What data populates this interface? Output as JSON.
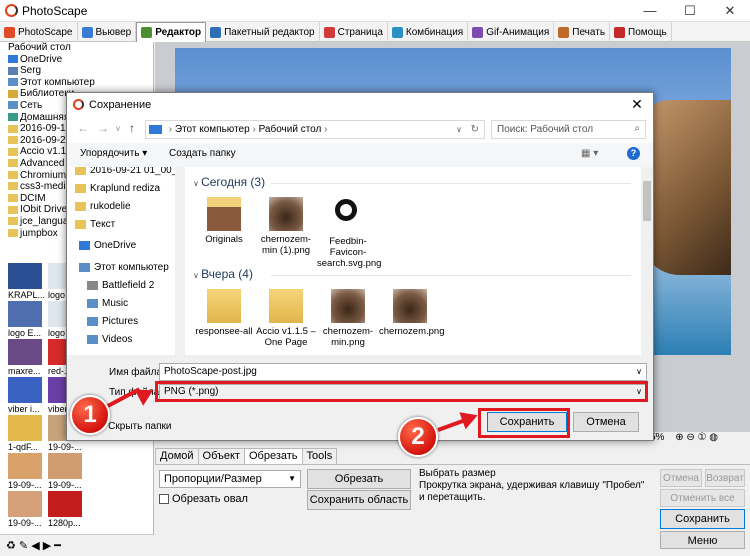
{
  "app": {
    "title": "PhotoScape",
    "minimize": "—",
    "maximize": "☐",
    "close": "✕"
  },
  "tabs": [
    {
      "label": "PhotoScape",
      "color": "#e24b2a"
    },
    {
      "label": "Вьювер",
      "color": "#3a7bd5"
    },
    {
      "label": "Редактор",
      "color": "#4b8d2f"
    },
    {
      "label": "Пакетный редактор",
      "color": "#2f6fb5"
    },
    {
      "label": "Страница",
      "color": "#d13b3b"
    },
    {
      "label": "Комбинация",
      "color": "#2a8fc4"
    },
    {
      "label": "Gif-Анимация",
      "color": "#7b4bb0"
    },
    {
      "label": "Печать",
      "color": "#c06a2a"
    },
    {
      "label": "Помощь",
      "color": "#c42a2a"
    }
  ],
  "tree": [
    "Рабочий стол",
    "OneDrive",
    "Serg",
    "Этот компьютер",
    "Библиотеки",
    "Сеть",
    "Домашняя группа",
    "2016-09-1",
    "2016-09-2",
    "Accio v1.1",
    "Advanced",
    "Chromium",
    "css3-media",
    "DCIM",
    "IObit Drive",
    "jce_langua",
    "jumpbox"
  ],
  "thumbs": [
    {
      "label": "KRAPL..."
    },
    {
      "label": "logo"
    },
    {
      "label": "logo E..."
    },
    {
      "label": "logo"
    },
    {
      "label": "maxre..."
    },
    {
      "label": "red-..."
    },
    {
      "label": "viber i..."
    },
    {
      "label": "viber"
    },
    {
      "label": "1-qdF..."
    },
    {
      "label": "19-09-..."
    },
    {
      "label": "19-09-..."
    },
    {
      "label": "19-09-..."
    },
    {
      "label": "19-09-..."
    },
    {
      "label": "1280p..."
    }
  ],
  "zoom": {
    "value": "5%"
  },
  "bottom": {
    "tabs": [
      "Домой",
      "Объект",
      "Обрезать",
      "Tools"
    ],
    "active_tab": "Обрезать",
    "crop_mode": "Пропорции/Размер",
    "crop_button": "Обрезать",
    "oval_checkbox": "Обрезать овал",
    "save_area_button": "Сохранить область",
    "hint_title": "Выбрать размер",
    "hint_text": "Прокрутка экрана, удерживая клавишу \"Пробел\" и перетащить.",
    "undo": "Отмена",
    "redo": "Возврат",
    "undo_all": "Отменить все",
    "save": "Сохранить",
    "menu": "Меню"
  },
  "dialog": {
    "title": "Сохранение",
    "close": "✕",
    "path": [
      "Этот компьютер",
      "Рабочий стол"
    ],
    "search_placeholder": "Поиск: Рабочий стол",
    "organize": "Упорядочить ▾",
    "new_folder": "Создать папку",
    "help": "?",
    "nav_items": [
      {
        "label": "2016-09-21 01_00_",
        "color": "#e8c35a"
      },
      {
        "label": "Kraplund rediza",
        "color": "#e8c35a"
      },
      {
        "label": "rukodelie",
        "color": "#e8c35a"
      },
      {
        "label": "Текст",
        "color": "#e8c35a"
      },
      {
        "label": "OneDrive",
        "color": "#2f7ad6"
      },
      {
        "label": "Этот компьютер",
        "color": "#5a8ec6"
      },
      {
        "label": "Battlefield 2",
        "color": "#888888"
      },
      {
        "label": "Music",
        "color": "#5a8ec6"
      },
      {
        "label": "Pictures",
        "color": "#5a8ec6"
      },
      {
        "label": "Videos",
        "color": "#5a8ec6"
      }
    ],
    "groups": [
      {
        "label": "Сегодня (3)",
        "files": [
          {
            "name": "Originals",
            "kind": "folder-photo"
          },
          {
            "name": "chernozem-min (1).png",
            "kind": "soil"
          },
          {
            "name": "Feedbin-Favicon-search.svg.png",
            "kind": "search"
          }
        ]
      },
      {
        "label": "Вчера (4)",
        "files": [
          {
            "name": "responsee-all",
            "kind": "folder-doc"
          },
          {
            "name": "Accio v1.1.5 – One Page",
            "kind": "folder-doc"
          },
          {
            "name": "chernozem-min.png",
            "kind": "soil"
          },
          {
            "name": "chernozem.png",
            "kind": "soil"
          }
        ]
      }
    ],
    "filename_label": "Имя файла:",
    "filename": "PhotoScape-post.jpg",
    "filetype_label": "Тип файла:",
    "filetype": "PNG (*.png)",
    "hide_folders": "Скрыть папки",
    "save": "Сохранить",
    "cancel": "Отмена"
  },
  "annotations": {
    "step1": "1",
    "step2": "2",
    "color": "#e0181f"
  }
}
